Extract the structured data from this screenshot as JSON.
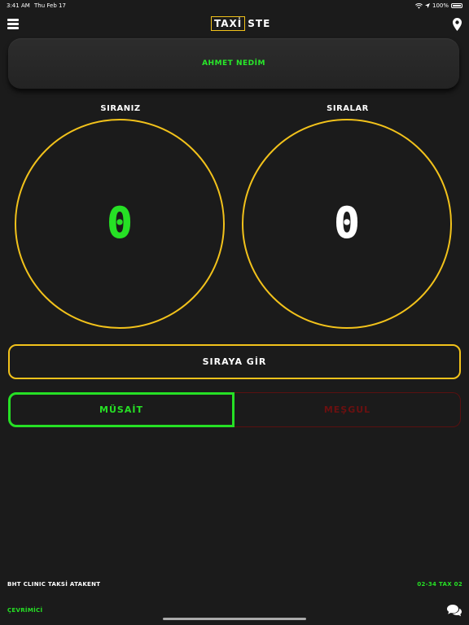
{
  "status_bar": {
    "time": "3:41 AM",
    "date": "Thu Feb 17",
    "battery": "100%"
  },
  "header": {
    "logo_box": "TAXİ",
    "logo_rest": "STE",
    "menu_icon": "hamburger-icon",
    "location_icon": "map-pin-icon"
  },
  "driver": {
    "name": "AHMET NEDİM"
  },
  "counters": [
    {
      "label": "SIRANIZ",
      "value": "0",
      "color": "#26e025"
    },
    {
      "label": "SIRALAR",
      "value": "0",
      "color": "#ffffff"
    }
  ],
  "actions": {
    "queue_button": "SIRAYA GİR"
  },
  "status_toggle": {
    "available": "MÜSAİT",
    "busy": "MEŞGUL",
    "selected": "available"
  },
  "footer": {
    "stand_name": "BHT CLINIC TAKSİ ATAKENT",
    "plate": "02-34 TAX 02",
    "online_status": "ÇEVRİMİCİ",
    "chat_icon": "chat-icon"
  },
  "colors": {
    "accent": "#f2c21b",
    "green": "#26e025",
    "busy_red": "#6b1010",
    "background": "#1b1b1b"
  }
}
